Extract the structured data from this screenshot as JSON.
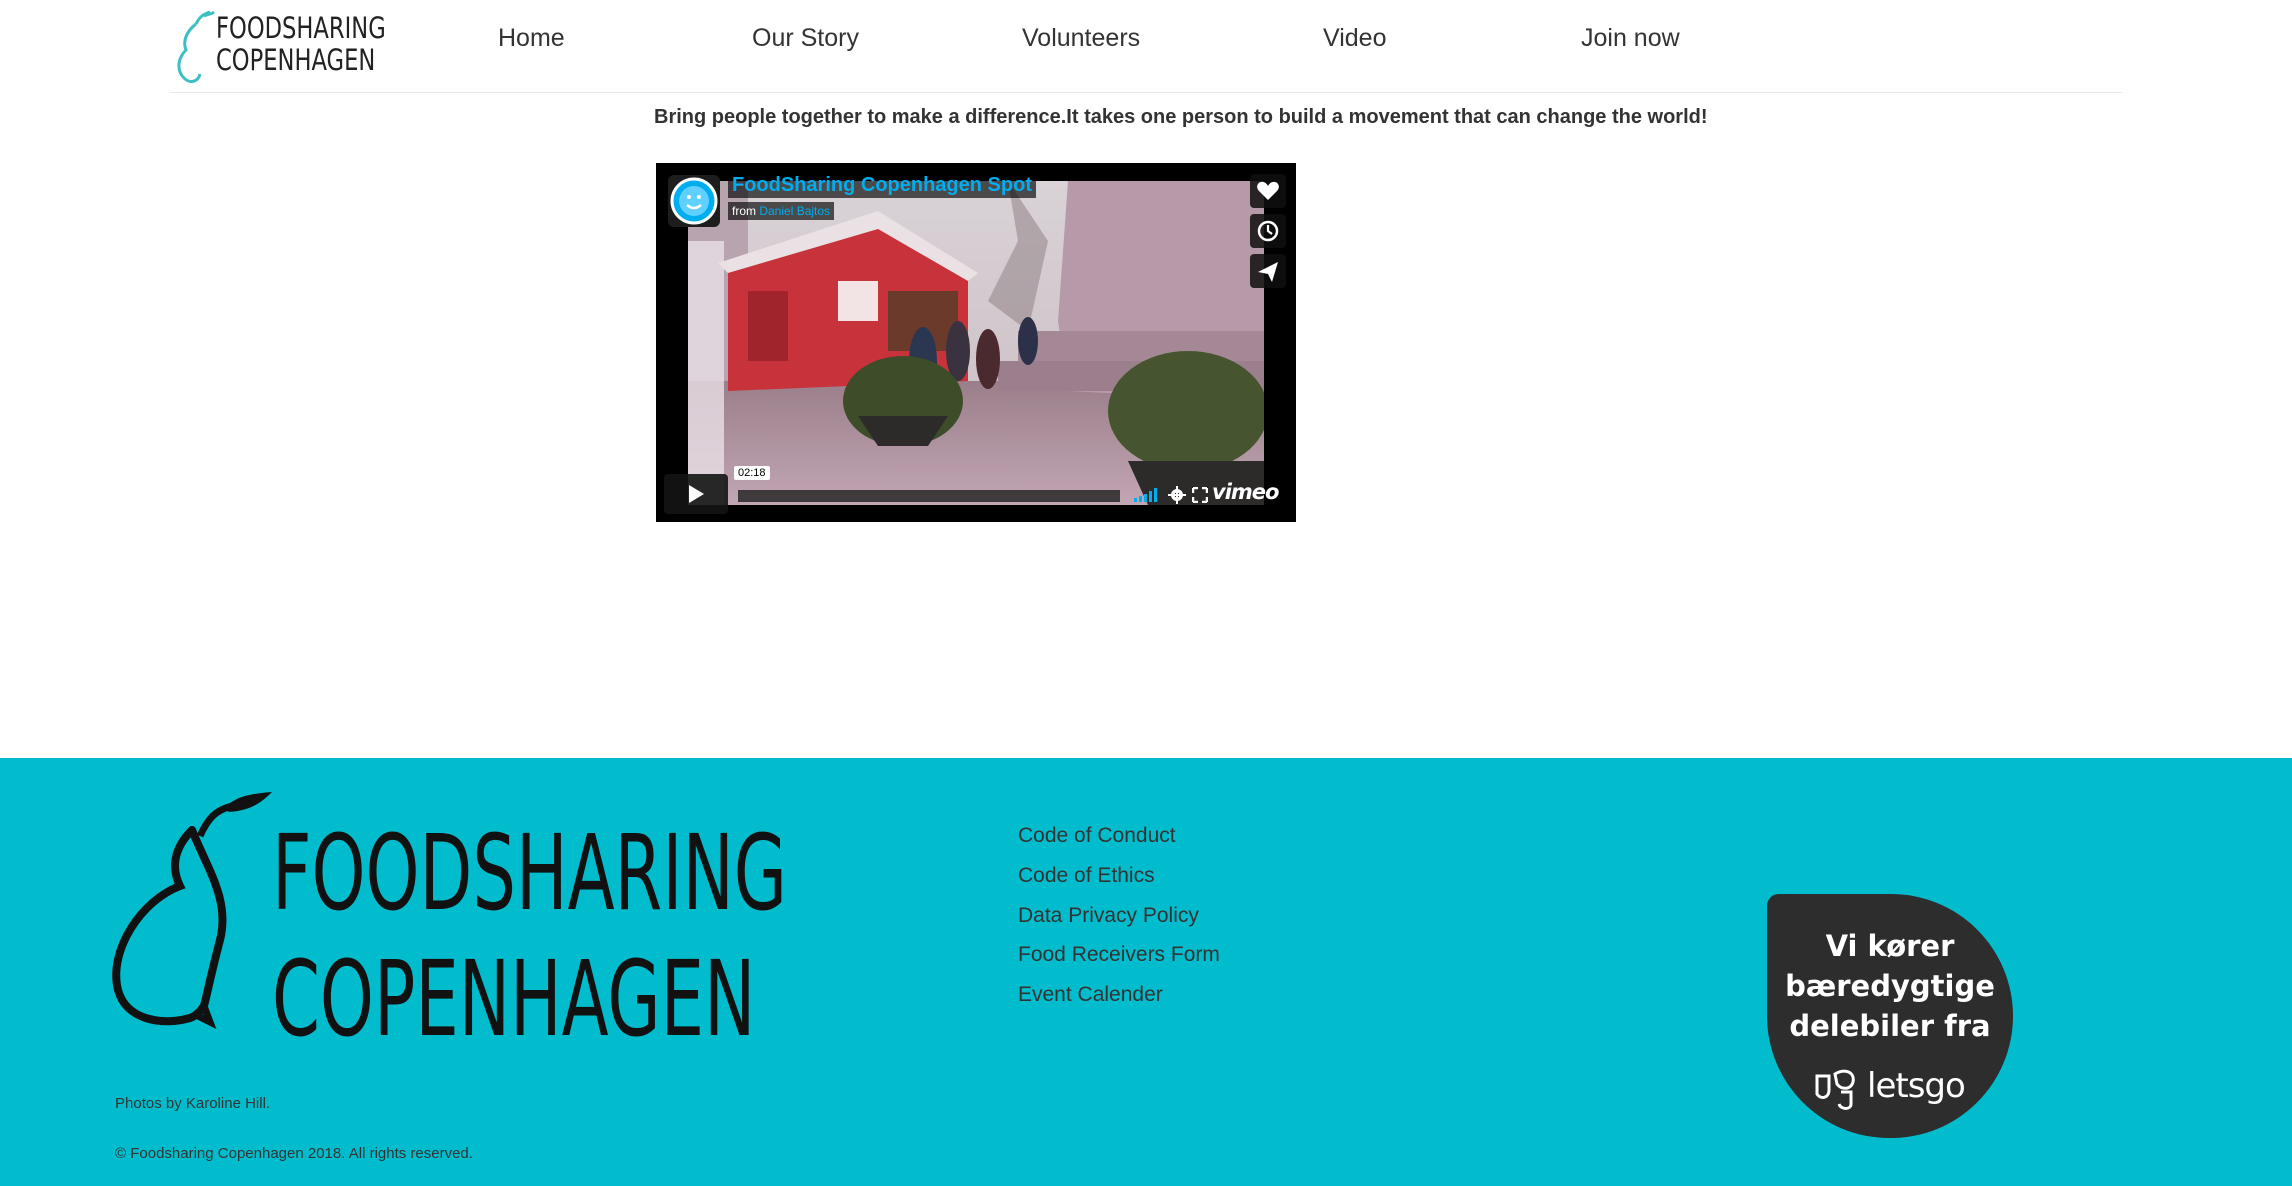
{
  "header": {
    "logo": {
      "line1": "FOODSHARING",
      "line2": "COPENHAGEN"
    },
    "nav": [
      {
        "label": "Home"
      },
      {
        "label": "Our Story"
      },
      {
        "label": "Volunteers"
      },
      {
        "label": "Video"
      },
      {
        "label": "Join now"
      }
    ]
  },
  "main": {
    "tagline": "Bring people together to make a difference.It takes one person to build a movement that can change the world!",
    "video": {
      "title": "FoodSharing Copenhagen Spot",
      "byline_prefix": "from",
      "author": "Daniel Bajtos",
      "duration": "02:18",
      "player_brand": "vimeo"
    }
  },
  "footer": {
    "logo": {
      "line1": "FOODSHARING",
      "line2": "COPENHAGEN"
    },
    "links": [
      {
        "label": "Code of Conduct"
      },
      {
        "label": "Code of Ethics"
      },
      {
        "label": "Data Privacy Policy"
      },
      {
        "label": "Food Receivers Form"
      },
      {
        "label": "Event Calender"
      }
    ],
    "photo_credit": "Photos by Karoline Hill.",
    "copyright": "© Foodsharing Copenhagen 2018. All rights reserved.",
    "partner": {
      "line1": "Vi kører",
      "line2": "bæredygtige",
      "line3": "delebiler fra",
      "brand": "letsgo"
    }
  },
  "colors": {
    "footer_bg": "#00bccc",
    "accent_blue": "#00adef",
    "logo_pear": "#3cbfc3"
  }
}
